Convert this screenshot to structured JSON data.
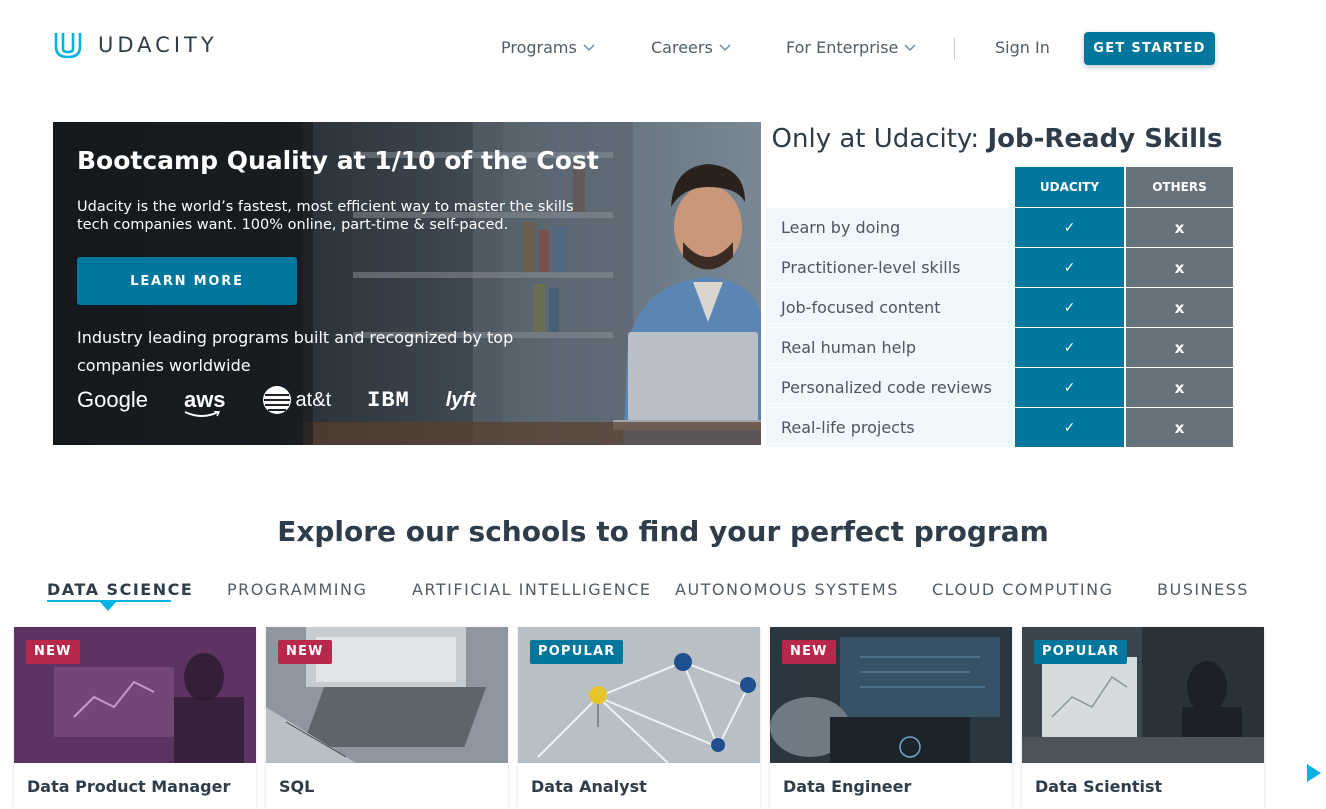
{
  "brand": {
    "name": "UDACITY",
    "color": "#02779e",
    "accent": "#02b3e4"
  },
  "nav": {
    "items": [
      {
        "label": "Programs"
      },
      {
        "label": "Careers"
      },
      {
        "label": "For Enterprise"
      }
    ],
    "sign_in": "Sign In",
    "cta": "GET STARTED"
  },
  "hero": {
    "title": "Bootcamp Quality at 1/10 of the Cost",
    "subtitle": "Udacity is the world’s fastest, most efficient way to master the skills tech companies want. 100% online, part-time & self-paced.",
    "cta": "LEARN MORE",
    "industry_text": "Industry leading programs built and recognized by top companies worldwide",
    "partners": [
      "Google",
      "aws",
      "at&t",
      "IBM",
      "lyft"
    ]
  },
  "comparison": {
    "title_prefix": "Only at Udacity: ",
    "title_bold": "Job-Ready Skills",
    "col_udacity": "UDACITY",
    "col_others": "OTHERS",
    "rows": [
      {
        "label": "Learn by doing",
        "udacity": "✓",
        "others": "x"
      },
      {
        "label": "Practitioner-level skills",
        "udacity": "✓",
        "others": "x"
      },
      {
        "label": "Job-focused content",
        "udacity": "✓",
        "others": "x"
      },
      {
        "label": "Real human help",
        "udacity": "✓",
        "others": "x"
      },
      {
        "label": "Personalized code reviews",
        "udacity": "✓",
        "others": "x"
      },
      {
        "label": "Real-life projects",
        "udacity": "✓",
        "others": "x"
      }
    ]
  },
  "schools": {
    "title": "Explore our schools to find your perfect program",
    "tabs": [
      "DATA SCIENCE",
      "PROGRAMMING",
      "ARTIFICIAL INTELLIGENCE",
      "AUTONOMOUS SYSTEMS",
      "CLOUD COMPUTING",
      "BUSINESS"
    ],
    "active_tab": "DATA SCIENCE",
    "cards": [
      {
        "badge": "NEW",
        "name": "Data Product Manager"
      },
      {
        "badge": "NEW",
        "name": "SQL"
      },
      {
        "badge": "POPULAR",
        "name": "Data Analyst"
      },
      {
        "badge": "NEW",
        "name": "Data Engineer"
      },
      {
        "badge": "POPULAR",
        "name": "Data Scientist"
      }
    ]
  }
}
